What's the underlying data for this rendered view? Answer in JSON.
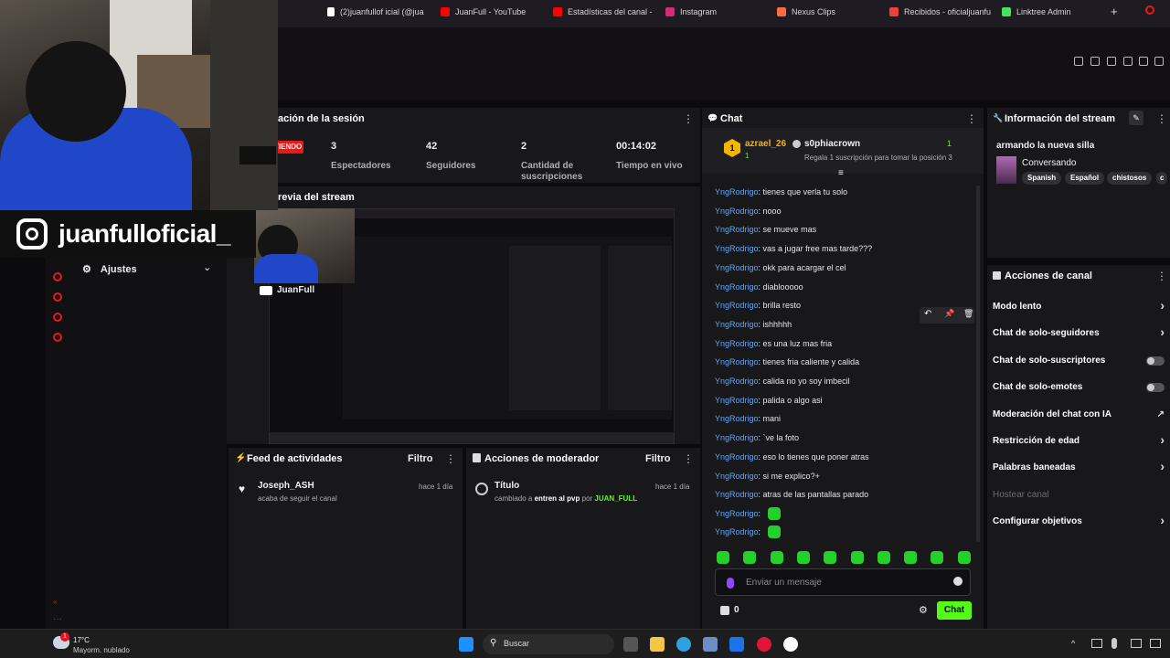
{
  "browser": {
    "tabs": [
      {
        "label": "(2)juanfullof icial (@jua",
        "color": "#ffffff"
      },
      {
        "label": "JuanFull - YouTube",
        "color": "#ff0000"
      },
      {
        "label": "Estadísticas del canal -",
        "color": "#ff0000"
      },
      {
        "label": "Instagram",
        "color": "#d62976"
      },
      {
        "label": "Nexus Clips",
        "color": "#ff6b3d"
      },
      {
        "label": "Recibidos - oficialjuanfu",
        "color": "#ea4335"
      },
      {
        "label": "Linktree Admin",
        "color": "#43e55e"
      }
    ]
  },
  "overlay": {
    "instagram_handle": "juanfulloficial_",
    "youtube_name": "JuanFull"
  },
  "session": {
    "title": "ación de la sesión",
    "live_badge": "TIENDO",
    "stats": [
      {
        "value": "3",
        "label": "Espectadores"
      },
      {
        "value": "42",
        "label": "Seguidores"
      },
      {
        "value": "2",
        "label": "Cantidad de suscripciones"
      },
      {
        "value": "00:14:02",
        "label": "Tiempo en vivo"
      }
    ]
  },
  "preview": {
    "title": "revia del stream"
  },
  "left_rail": {
    "ajustes_label": "Ajustes"
  },
  "activity_feed": {
    "title": "Feed de actividades",
    "filter": "Filtro",
    "item": {
      "user": "Joseph_ASH",
      "action": "acaba de seguir el canal",
      "time": "hace 1 día"
    }
  },
  "mod_actions": {
    "title": "Acciones de moderador",
    "filter": "Filtro",
    "item": {
      "heading": "Título",
      "prefix": "cambiado a",
      "value": "entren al pvp",
      "by": "por",
      "mod": "JUAN_FULL",
      "time": "hace 1 día"
    }
  },
  "chat": {
    "title": "Chat",
    "pinned": {
      "rank": "1",
      "user": "azrael_26",
      "gifts": "1",
      "gifter": "s0phiacrown",
      "gift_count": "1",
      "message": "Regala 1 suscripción para tomar la posición 3"
    },
    "username": "YngRodrigo",
    "messages": [
      "tienes que verla tu solo",
      "nooo",
      "se mueve mas",
      "vas a jugar free mas tarde???",
      "okk para acargar el cel",
      "diablooooo",
      "brilla resto",
      "ishhhhh",
      "es una luz mas fria",
      "tienes fria caliente y calida",
      "calida no yo soy imbecil",
      "palida o algo asi",
      "mani",
      "`ve la foto",
      "eso lo tienes que poner atras",
      "si me explico?+",
      "atras de las pantallas parado"
    ],
    "input_placeholder": "Enviar un mensaje",
    "points": "0",
    "send_label": "Chat"
  },
  "stream_info": {
    "title": "Información del stream",
    "stream_title": "armando la nueva silla",
    "category": "Conversando",
    "tags": [
      "Spanish",
      "Español",
      "chistosos",
      "c"
    ]
  },
  "channel_actions": {
    "title": "Acciones de canal",
    "items": [
      {
        "label": "Modo lento",
        "kind": "chevron"
      },
      {
        "label": "Chat de solo-seguidores",
        "kind": "chevron"
      },
      {
        "label": "Chat de solo-suscriptores",
        "kind": "toggle"
      },
      {
        "label": "Chat de solo-emotes",
        "kind": "toggle"
      },
      {
        "label": "Moderación del chat con IA",
        "kind": "external"
      },
      {
        "label": "Restricción de edad",
        "kind": "chevron"
      },
      {
        "label": "Palabras baneadas",
        "kind": "chevron"
      },
      {
        "label": "Hostear canal",
        "kind": "disabled"
      },
      {
        "label": "Configurar objetivos",
        "kind": "chevron"
      }
    ]
  },
  "taskbar": {
    "temperature": "17°C",
    "weather": "Mayorm. nublado",
    "search_placeholder": "Buscar",
    "notif_count": "1"
  },
  "accent": "#53fc18"
}
